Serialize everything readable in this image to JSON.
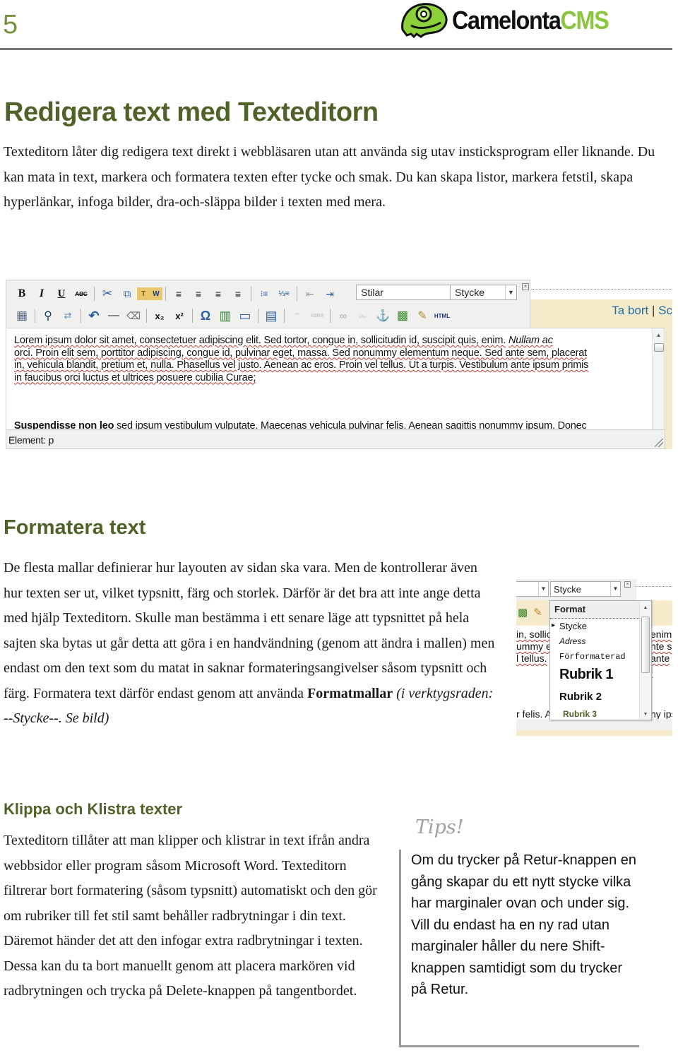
{
  "header": {
    "page_number": "5",
    "logo": {
      "name": "Camelonta",
      "suffix": "CMS",
      "brand_color": "#8cc63f"
    }
  },
  "section1": {
    "title": "Redigera text med Texteditorn",
    "paragraph": "Texteditorn låter dig redigera text direkt i webbläsaren utan att använda sig utav insticksprogram eller liknande. Du kan mata in text, markera och formatera texten efter tycke och smak. Du kan skapa listor, markera fetstil, skapa hyperlänkar, infoga bilder, dra-och-släppa bilder i texten med mera."
  },
  "editor": {
    "toolbar_row1": [
      {
        "icon": "bold-icon",
        "glyph": "B"
      },
      {
        "icon": "italic-icon",
        "glyph": "I"
      },
      {
        "icon": "underline-icon",
        "glyph": "U"
      },
      {
        "icon": "strikethrough-icon",
        "glyph": "ABC"
      },
      {
        "sep": true
      },
      {
        "icon": "cut-icon",
        "glyph": "✂"
      },
      {
        "icon": "copy-icon",
        "glyph": "⧉"
      },
      {
        "icon": "paste-text-icon",
        "glyph": "T"
      },
      {
        "icon": "paste-word-icon",
        "glyph": "W"
      },
      {
        "sep": true
      },
      {
        "icon": "align-left-icon",
        "glyph": "≡"
      },
      {
        "icon": "align-center-icon",
        "glyph": "≡"
      },
      {
        "icon": "align-right-icon",
        "glyph": "≡"
      },
      {
        "icon": "align-justify-icon",
        "glyph": "≡"
      },
      {
        "sep": true
      },
      {
        "icon": "bullet-list-icon",
        "glyph": "⁝≡"
      },
      {
        "icon": "numbered-list-icon",
        "glyph": "⅓≡"
      },
      {
        "sep": true
      },
      {
        "icon": "outdent-icon",
        "glyph": "⇤"
      },
      {
        "icon": "indent-icon",
        "glyph": "⇥"
      }
    ],
    "toolbar_row2": [
      {
        "icon": "edit-table-icon",
        "glyph": "▦"
      },
      {
        "sep": true
      },
      {
        "icon": "find-icon",
        "glyph": "⚲"
      },
      {
        "icon": "replace-icon",
        "glyph": "⇄"
      },
      {
        "sep": true
      },
      {
        "icon": "undo-icon",
        "glyph": "↶"
      },
      {
        "icon": "horizontal-rule-icon",
        "glyph": "—"
      },
      {
        "icon": "eraser-icon",
        "glyph": "⌫"
      },
      {
        "sep": true
      },
      {
        "icon": "subscript-icon",
        "glyph": "x₂"
      },
      {
        "icon": "superscript-icon",
        "glyph": "x²"
      },
      {
        "sep": true
      },
      {
        "icon": "special-char-icon",
        "glyph": "Ω"
      },
      {
        "icon": "media-icon",
        "glyph": "▥"
      },
      {
        "icon": "input-field-icon",
        "glyph": "▭"
      },
      {
        "sep": true
      },
      {
        "icon": "template-icon",
        "glyph": "▤"
      },
      {
        "sep": true
      },
      {
        "icon": "quote-icon",
        "glyph": "“”"
      },
      {
        "icon": "abbr-icon",
        "glyph": "ABBR"
      },
      {
        "sep": true
      },
      {
        "icon": "link-icon",
        "glyph": "∞"
      },
      {
        "icon": "unlink-icon",
        "glyph": "⧜"
      },
      {
        "icon": "anchor-icon",
        "glyph": "⚓"
      },
      {
        "icon": "image-icon",
        "glyph": "▩"
      },
      {
        "icon": "cleanup-icon",
        "glyph": "✎"
      },
      {
        "icon": "html-icon",
        "glyph": "HTML"
      }
    ],
    "styles_select": "Stilar",
    "format_select": "Stycke",
    "close_glyph": "×",
    "links": {
      "remove": "Ta bort",
      "separator": "|",
      "next": "Sc"
    },
    "content": {
      "p1_words": [
        "Lorem",
        "ipsum",
        "dolor",
        "sit",
        "amet,",
        "consectetuer",
        "adipiscing",
        "elit.",
        "Sed",
        "tortor,",
        "congue",
        "in,",
        "sollicitudin",
        "id,",
        "suscipit",
        "quis,",
        "enim."
      ],
      "p1_italic": "Nullam",
      "p1_text_line1": "Lorem ipsum dolor sit amet, consectetuer adipiscing elit. Sed tortor, congue in, sollicitudin id, suscipit quis, enim.",
      "p1_text_line1_italic": "Nullam ac",
      "p1_text_line2": "orci. Proin elit sem, porttitor adipiscing, congue id, pulvinar eget, massa. Sed nonummy elementum neque. Sed ante sem, placerat",
      "p1_text_line3": "in, vehicula blandit, pretium et, nulla. Phasellus vel justo. Aenean ac eros. Proin vel tellus. Ut a turpis. Vestibulum ante ipsum primis",
      "p1_text_line4": "in faucibus orci luctus et ultrices posuere cubilia Curae;",
      "p2_bold": "Suspendisse non leo",
      "p2_rest": " sed ipsum vestibulum vulputate. Maecenas vehicula pulvinar felis. Aenean sagittis nonummy ipsum. Donec"
    },
    "status": "Element: p"
  },
  "section2": {
    "title": "Formatera text",
    "paragraph": "De flesta mallar definierar hur layouten av sidan ska vara. Men de kontrollerar även hur texten ser ut, vilket typsnitt, färg och storlek. Därför är det bra att inte ange detta med hjälp Texteditorn. Skulle man bestämma i ett senare läge att typsnittet på hela sajten ska bytas ut går detta att göra i en handvändning (genom att ändra i mallen) men endast om den text som du matat in saknar formateringsangivelser såsom typsnitt och färg. Formatera text därför endast genom att använda ",
    "bold_term": "Formatmallar",
    "italic_note": " (i verktygsraden: --Stycke--. Se bild)"
  },
  "format_dropdown": {
    "selected": "Stycke",
    "header": "Format",
    "items": [
      "Stycke",
      "Adress",
      "Förformaterad",
      "Rubrik 1",
      "Rubrik 2",
      "Rubrik 3"
    ],
    "bg_left": [
      "in, sollic",
      "ummy el",
      "l tellus."
    ],
    "bg_right": [
      "enim",
      "nte s",
      "ante i"
    ],
    "bg_bottom_left": "r felis. A",
    "bg_bottom_right": "ny ips"
  },
  "section3": {
    "title": "Klippa och Klistra texter",
    "paragraph": "Texteditorn tillåter att man klipper och klistrar in text ifrån andra webbsidor eller program såsom Microsoft Word. Texteditorn filtrerar bort formatering (såsom typsnitt) automatiskt och den gör om rubriker till fet stil samt behåller radbrytningar i din text. Däremot händer det att den infogar extra radbrytningar i texten. Dessa kan du ta bort manuellt genom att placera markören vid radbrytningen och trycka på Delete-knappen på tangentbordet."
  },
  "tips": {
    "title": "Tips!",
    "text": "Om du trycker på Retur-knappen en gång skapar du ett nytt stycke vilka har marginaler ovan och under sig. Vill du endast ha en ny rad utan marginaler håller du nere Shift-knappen samtidigt som du trycker på Retur."
  }
}
